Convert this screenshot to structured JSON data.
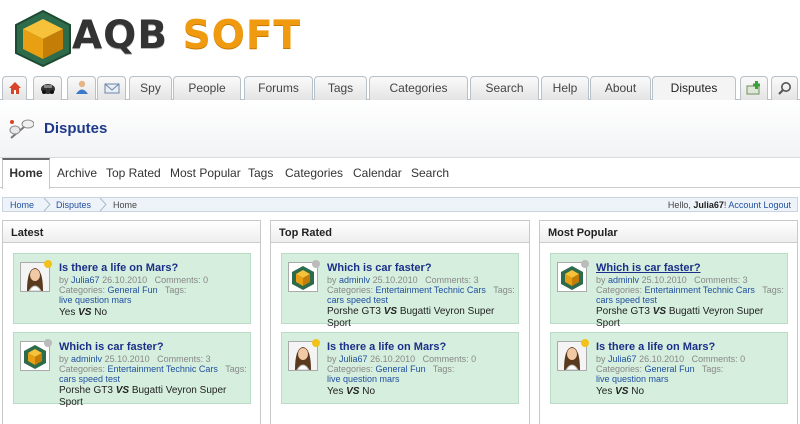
{
  "logo": {
    "part1": "AQB",
    "part2": "SOFT"
  },
  "topnav": {
    "icons": [
      "home-icon",
      "car-icon",
      "user-icon",
      "mail-icon"
    ],
    "tabs": [
      "Spy",
      "People",
      "Forums",
      "Tags",
      "Categories",
      "Search",
      "Help",
      "About",
      "Disputes"
    ],
    "right_icons": [
      "add-icon",
      "search-icon"
    ]
  },
  "page": {
    "title": "Disputes"
  },
  "subnav": [
    "Home",
    "Archive",
    "Top Rated",
    "Most Popular",
    "Tags",
    "Categories",
    "Calendar",
    "Search"
  ],
  "breadcrumb": {
    "items": [
      "Home",
      "Disputes",
      "Home"
    ],
    "hello": "Hello,",
    "user": "Julia67",
    "account": "Account",
    "logout": "Logout"
  },
  "columns": [
    {
      "title": "Latest",
      "cards": [
        {
          "avatar": "girl",
          "title": "Is there a life on Mars?",
          "by": "by",
          "author": "Julia67",
          "date": "26.10.2010",
          "comments": "Comments: 0",
          "cat_label": "Categories:",
          "cats": "General  Fun",
          "tags_label": "Tags:",
          "tags": "live  question  mars",
          "side1": "Yes",
          "vs": "VS",
          "side2": "No"
        },
        {
          "avatar": "cube",
          "title": "Which is car faster?",
          "by": "by",
          "author": "adminlv",
          "date": "25.10.2010",
          "comments": "Comments: 3",
          "cat_label": "Categories:",
          "cats": "Entertainment  Technic  Cars",
          "tags_label": "Tags:",
          "tags": "cars  speed test",
          "side1": "Porshe GT3",
          "vs": "VS",
          "side2": "Bugatti Veyron Super Sport"
        }
      ]
    },
    {
      "title": "Top Rated",
      "cards": [
        {
          "avatar": "cube",
          "title": "Which is car faster?",
          "by": "by",
          "author": "adminlv",
          "date": "25.10.2010",
          "comments": "Comments: 3",
          "cat_label": "Categories:",
          "cats": "Entertainment  Technic  Cars",
          "tags_label": "Tags:",
          "tags": "cars  speed test",
          "side1": "Porshe GT3",
          "vs": "VS",
          "side2": "Bugatti Veyron Super Sport"
        },
        {
          "avatar": "girl",
          "title": "Is there a life on Mars?",
          "by": "by",
          "author": "Julia67",
          "date": "26.10.2010",
          "comments": "Comments: 0",
          "cat_label": "Categories:",
          "cats": "General  Fun",
          "tags_label": "Tags:",
          "tags": "live  question  mars",
          "side1": "Yes",
          "vs": "VS",
          "side2": "No"
        }
      ]
    },
    {
      "title": "Most Popular",
      "cards": [
        {
          "avatar": "cube",
          "title": "Which is car faster?",
          "by": "by",
          "author": "adminlv",
          "date": "25.10.2010",
          "comments": "Comments: 3",
          "cat_label": "Categories:",
          "cats": "Entertainment  Technic  Cars",
          "tags_label": "Tags:",
          "tags": "cars  speed test",
          "side1": "Porshe GT3",
          "vs": "VS",
          "side2": "Bugatti Veyron Super Sport"
        },
        {
          "avatar": "girl",
          "title": "Is there a life on Mars?",
          "by": "by",
          "author": "Julia67",
          "date": "26.10.2010",
          "comments": "Comments: 0",
          "cat_label": "Categories:",
          "cats": "General  Fun",
          "tags_label": "Tags:",
          "tags": "live  question  mars",
          "side1": "Yes",
          "vs": "VS",
          "side2": "No"
        }
      ]
    }
  ],
  "colors": {
    "title_blue": "#1b2f8a",
    "link_blue": "#2050a0",
    "card_green": "#d5eedd",
    "accent_orange": "#f09a10"
  }
}
